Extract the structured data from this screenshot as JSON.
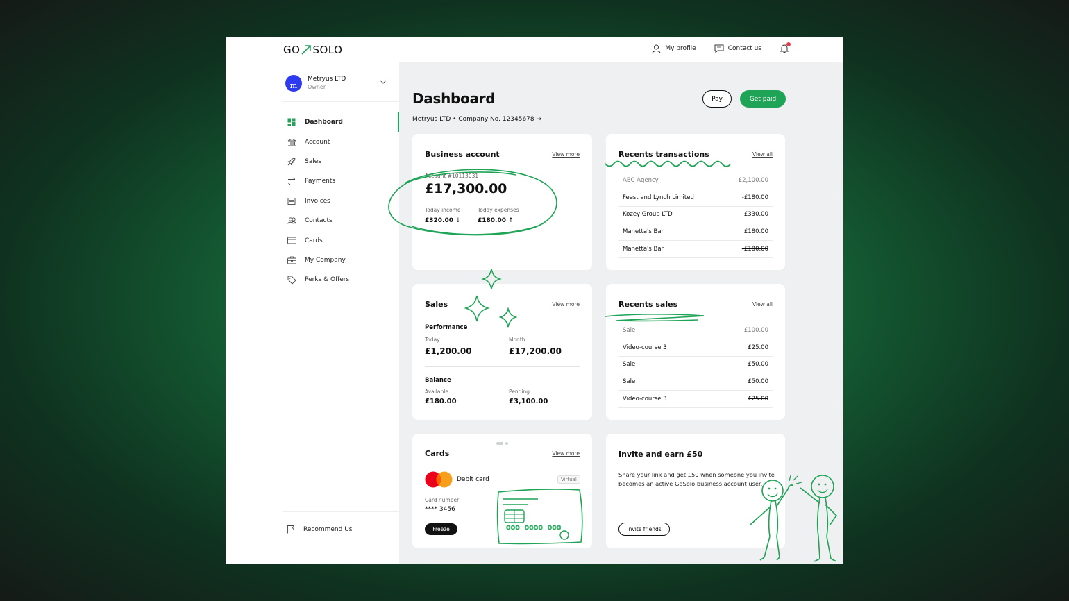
{
  "brand": {
    "logo_left": "GO",
    "logo_right": "SOLO",
    "accent": "#1fa356"
  },
  "header": {
    "my_profile": "My profile",
    "contact_us": "Contact us",
    "icons": [
      "user-icon",
      "chat-icon",
      "bell-icon"
    ]
  },
  "org": {
    "name": "Metryus LTD",
    "role": "Owner",
    "avatar_letter": "m"
  },
  "sidebar": {
    "items": [
      {
        "label": "Dashboard",
        "icon": "dashboard-icon",
        "active": true
      },
      {
        "label": "Account",
        "icon": "bank-icon"
      },
      {
        "label": "Sales",
        "icon": "rocket-icon"
      },
      {
        "label": "Payments",
        "icon": "transfer-icon"
      },
      {
        "label": "Invoices",
        "icon": "invoice-icon"
      },
      {
        "label": "Contacts",
        "icon": "contacts-icon"
      },
      {
        "label": "Cards",
        "icon": "card-icon"
      },
      {
        "label": "My Company",
        "icon": "briefcase-icon"
      },
      {
        "label": "Perks & Offers",
        "icon": "tag-icon"
      }
    ],
    "recommend": "Recommend Us"
  },
  "page": {
    "title": "Dashboard",
    "company_line": "Metryus LTD • Company No. 12345678 →",
    "pay": "Pay",
    "get_paid": "Get paid"
  },
  "business_account": {
    "title": "Business account",
    "view_more": "View more",
    "account_no": "Account #10113031",
    "balance": "£17,300.00",
    "income_label": "Today income",
    "income_value": "£320.00",
    "expenses_label": "Today expenses",
    "expenses_value": "£180.00"
  },
  "transactions": {
    "title": "Recents transactions",
    "view_all": "View all",
    "rows": [
      {
        "name": "ABC Agency",
        "amount": "£2,100.00"
      },
      {
        "name": "Feest and Lynch Limited",
        "amount": "-£180.00"
      },
      {
        "name": "Kozey Group LTD",
        "amount": "£330.00"
      },
      {
        "name": "Manetta's Bar",
        "amount": "£180.00"
      },
      {
        "name": "Manetta's Bar",
        "amount": "-£180.00"
      }
    ]
  },
  "sales": {
    "title": "Sales",
    "view_more": "View more",
    "performance": "Performance",
    "today_label": "Today",
    "today_value": "£1,200.00",
    "month_label": "Month",
    "month_value": "£17,200.00",
    "balance": "Balance",
    "available_label": "Available",
    "available_value": "£180.00",
    "pending_label": "Pending",
    "pending_value": "£3,100.00"
  },
  "recent_sales": {
    "title": "Recents sales",
    "view_all": "View all",
    "rows": [
      {
        "name": "Sale",
        "amount": "£100.00"
      },
      {
        "name": "Video-course 3",
        "amount": "£25.00"
      },
      {
        "name": "Sale",
        "amount": "£50.00"
      },
      {
        "name": "Sale",
        "amount": "£50.00"
      },
      {
        "name": "Video-course 3",
        "amount": "£25.00"
      }
    ]
  },
  "cards": {
    "title": "Cards",
    "view_more": "View more",
    "card_name": "Debit card",
    "badge": "Virtual",
    "number_label": "Card number",
    "number": "**** 3456",
    "freeze": "Freeze"
  },
  "invite": {
    "title": "Invite and earn £50",
    "text": "Share your link and get £50 when someone you invite becomes an active GoSolo business account user.",
    "button": "Invite friends"
  }
}
